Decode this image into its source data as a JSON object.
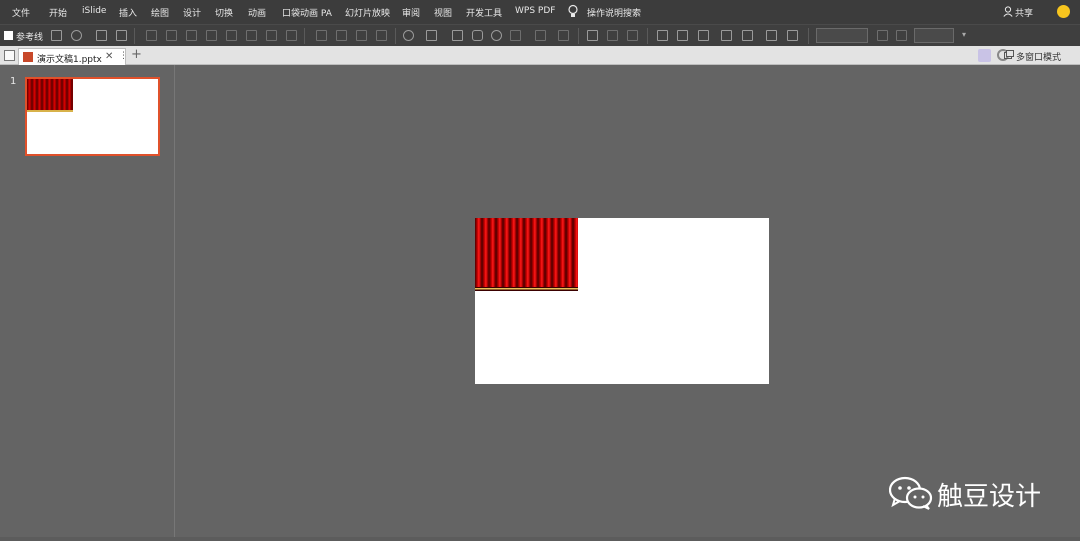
{
  "menu": {
    "items": [
      "文件",
      "开始",
      "iSlide",
      "插入",
      "绘图",
      "设计",
      "切换",
      "动画",
      "口袋动画 PA",
      "幻灯片放映",
      "审阅",
      "视图",
      "开发工具",
      "WPS PDF"
    ],
    "search_label": "操作说明搜索",
    "share_label": "共享"
  },
  "toolbar": {
    "reference_lines_label": "参考线"
  },
  "tabs": {
    "document_title": "演示文稿1.pptx",
    "close_glyph": "✕",
    "more_glyph": "⋮",
    "add_glyph": "+",
    "multi_window_label": "多窗口模式"
  },
  "slides_panel": {
    "slide_number": "1"
  },
  "watermark": {
    "text": "触豆设计"
  },
  "colors": {
    "accent": "#e0512b",
    "menubar": "#3c3c3c",
    "workspace": "#646464",
    "curtain": "#b00000"
  }
}
